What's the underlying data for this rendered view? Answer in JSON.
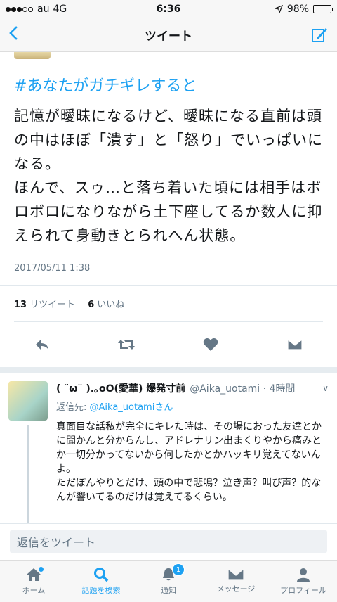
{
  "status_bar": {
    "carrier": "au",
    "network": "4G",
    "time": "6:36",
    "battery": "98%",
    "battery_level": 0.98
  },
  "nav": {
    "title": "ツイート",
    "back_icon": "chevron-left-icon",
    "compose_icon": "compose-icon"
  },
  "tweet": {
    "hashtag": "#あなたがガチギレすると",
    "text": "記憶が曖昧になるけど、曖昧になる直前は頭の中はほぼ「潰す」と「怒り」でいっぱいになる。\nほんで、スゥ…と落ち着いた頃には相手はボロボロになりながら土下座してるか数人に抑えられて身動きとられへん状態。",
    "timestamp": "2017/05/11 1:38",
    "retweets_count": "13",
    "retweets_label": "リツイート",
    "likes_count": "6",
    "likes_label": "いいね"
  },
  "reply": {
    "name": "( ˘ω˘ ).｡oO(愛華) 爆発寸前",
    "handle": "@Aika_uotami · 4時間",
    "reply_to_label": "返信先: ",
    "reply_to_user": "@Aika_uotamiさん",
    "text": "真面目な話私が完全にキレた時は、その場におった友達とかに聞かんと分からんし、アドレナリン出まくりやから痛みとか一切分かってないから何したかとかハッキリ覚えてないんよ。\nただぼんやりとだけ、頭の中で悲鳴？泣き声？叫び声？的なんが響いてるのだけは覚えてるくらい。"
  },
  "reply_box": {
    "placeholder": "返信をツイート"
  },
  "tabs": [
    {
      "label": "ホーム",
      "icon": "home-icon"
    },
    {
      "label": "話題を検索",
      "icon": "search-icon"
    },
    {
      "label": "通知",
      "icon": "bell-icon",
      "badge": "1"
    },
    {
      "label": "メッセージ",
      "icon": "mail-icon"
    },
    {
      "label": "プロフィール",
      "icon": "profile-icon"
    }
  ],
  "colors": {
    "accent": "#1da1f2",
    "muted": "#657786"
  }
}
